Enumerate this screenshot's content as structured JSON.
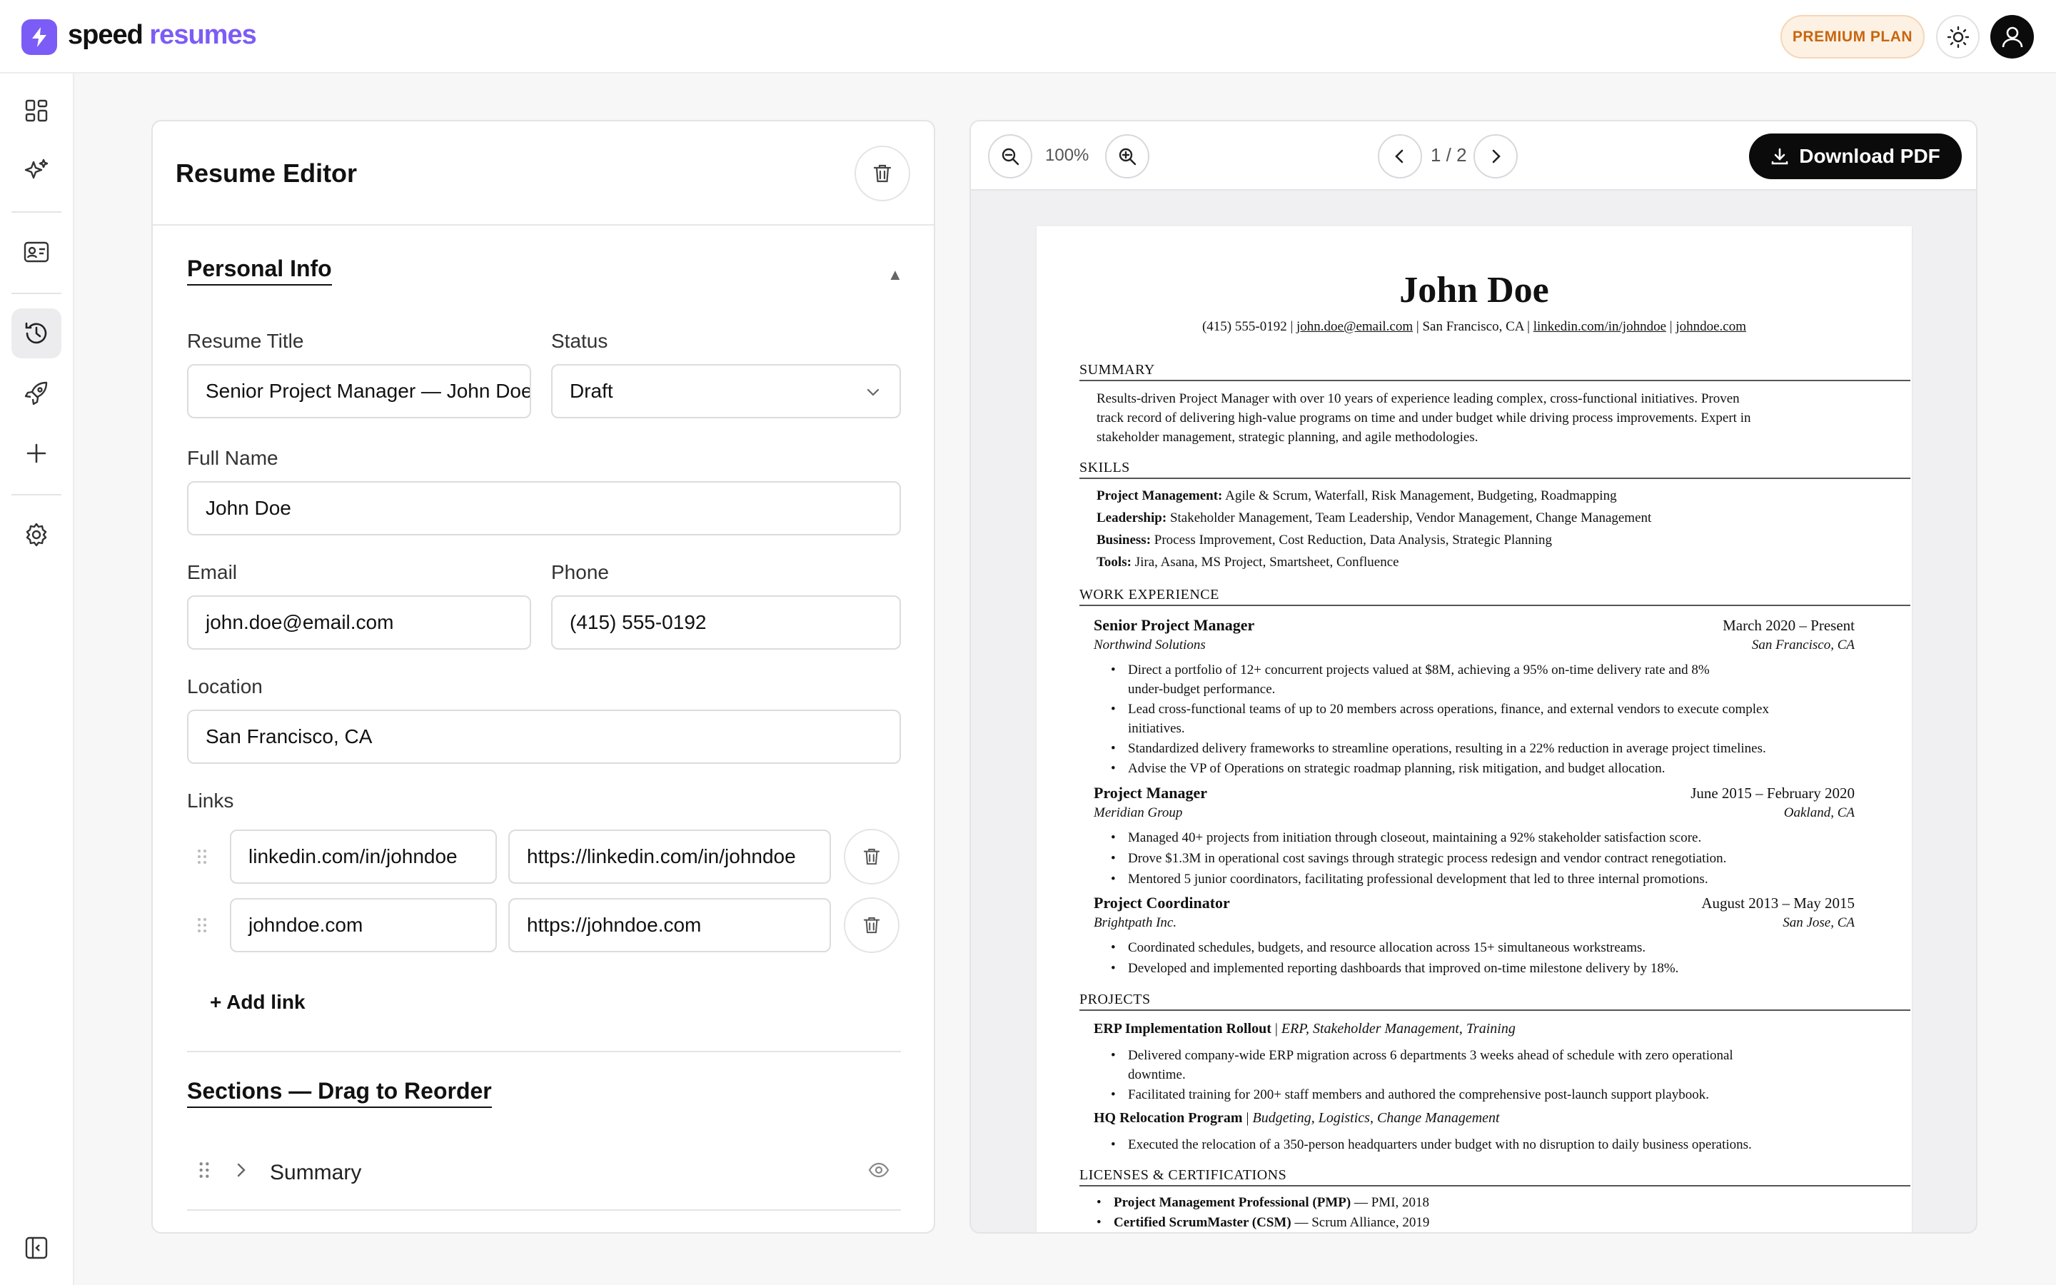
{
  "app": {
    "logo_word1": "speed",
    "logo_word2": "resumes",
    "plan_badge": "PREMIUM PLAN",
    "accent": "#7c5cf6"
  },
  "sidebar": {
    "items": [
      "dashboard-icon",
      "sparkles-icon",
      "id-card-icon",
      "history-icon",
      "rocket-icon",
      "plus-icon",
      "settings-icon",
      "panel-toggle-icon"
    ],
    "active": "history-icon"
  },
  "editor": {
    "title": "Resume Editor",
    "personal_heading": "Personal Info",
    "resume_title_label": "Resume Title",
    "resume_title_value": "Senior Project Manager — John Doe",
    "status_label": "Status",
    "status_value": "Draft",
    "full_name_label": "Full Name",
    "full_name_value": "John Doe",
    "email_label": "Email",
    "email_value": "john.doe@email.com",
    "phone_label": "Phone",
    "phone_value": "(415) 555-0192",
    "location_label": "Location",
    "location_value": "San Francisco, CA",
    "links_label": "Links",
    "links": [
      {
        "label": "linkedin.com/in/johndoe",
        "url": "https://linkedin.com/in/johndoe"
      },
      {
        "label": "johndoe.com",
        "url": "https://johndoe.com"
      }
    ],
    "add_link": "+ Add link",
    "sections_heading": "Sections — Drag to Reorder",
    "section_rows": [
      "Summary"
    ]
  },
  "preview": {
    "zoom": "100%",
    "page": "1 / 2",
    "download": "Download PDF"
  },
  "resume": {
    "name": "John Doe",
    "contact_phone": "(415) 555-0192",
    "contact_email": "john.doe@email.com",
    "contact_location": "San Francisco, CA",
    "contact_linkedin": "linkedin.com/in/johndoe",
    "contact_site": "johndoe.com",
    "sep": "|",
    "summary_heading": "SUMMARY",
    "summary_lines": [
      "Results-driven Project Manager with over 10 years of experience leading complex, cross-functional initiatives. Proven",
      "track record of delivering high-value programs on time and under budget while driving process improvements. Expert in",
      "stakeholder management, strategic planning, and agile methodologies."
    ],
    "skills_heading": "SKILLS",
    "skills": [
      {
        "k": "Project Management:",
        "v": "Agile & Scrum, Waterfall, Risk Management, Budgeting, Roadmapping"
      },
      {
        "k": "Leadership:",
        "v": "Stakeholder Management, Team Leadership, Vendor Management, Change Management"
      },
      {
        "k": "Business:",
        "v": "Process Improvement, Cost Reduction, Data Analysis, Strategic Planning"
      },
      {
        "k": "Tools:",
        "v": "Jira, Asana, MS Project, Smartsheet, Confluence"
      }
    ],
    "work_heading": "WORK EXPERIENCE",
    "jobs": [
      {
        "role": "Senior Project Manager",
        "dates": "March 2020 – Present",
        "org": "Northwind Solutions",
        "loc": "San Francisco, CA",
        "bullets": [
          "Direct a portfolio of 12+ concurrent projects valued at $8M, achieving a 95% on-time delivery rate and 8%",
          "under-budget performance.",
          "Lead cross-functional teams of up to 20 members across operations, finance, and external vendors to execute complex",
          "initiatives.",
          "Standardized delivery frameworks to streamline operations, resulting in a 22% reduction in average project timelines.",
          "Advise the VP of Operations on strategic roadmap planning, risk mitigation, and budget allocation."
        ]
      },
      {
        "role": "Project Manager",
        "dates": "June 2015 – February 2020",
        "org": "Meridian Group",
        "loc": "Oakland, CA",
        "bullets": [
          "Managed 40+ projects from initiation through closeout, maintaining a 92% stakeholder satisfaction score.",
          "Drove $1.3M in operational cost savings through strategic process redesign and vendor contract renegotiation.",
          "Mentored 5 junior coordinators, facilitating professional development that led to three internal promotions."
        ]
      },
      {
        "role": "Project Coordinator",
        "dates": "August 2013 – May 2015",
        "org": "Brightpath Inc.",
        "loc": "San Jose, CA",
        "bullets": [
          "Coordinated schedules, budgets, and resource allocation across 15+ simultaneous workstreams.",
          "Developed and implemented reporting dashboards that improved on-time milestone delivery by 18%."
        ]
      }
    ],
    "projects_heading": "PROJECTS",
    "projects": [
      {
        "name": "ERP Implementation Rollout",
        "tags": "ERP, Stakeholder Management, Training",
        "bullets": [
          "Delivered company-wide ERP migration across 6 departments 3 weeks ahead of schedule with zero operational",
          "downtime.",
          "Facilitated training for 200+ staff members and authored the comprehensive post-launch support playbook."
        ]
      },
      {
        "name": "HQ Relocation Program",
        "tags": "Budgeting, Logistics, Change Management",
        "bullets": [
          "Executed the relocation of a 350-person headquarters under budget with no disruption to daily business operations."
        ]
      }
    ],
    "certs_heading": "LICENSES & CERTIFICATIONS",
    "certs": [
      {
        "name": "Project Management Professional (PMP)",
        "detail": "— PMI, 2018"
      },
      {
        "name": "Certified ScrumMaster (CSM)",
        "detail": "— Scrum Alliance, 2019"
      }
    ]
  }
}
